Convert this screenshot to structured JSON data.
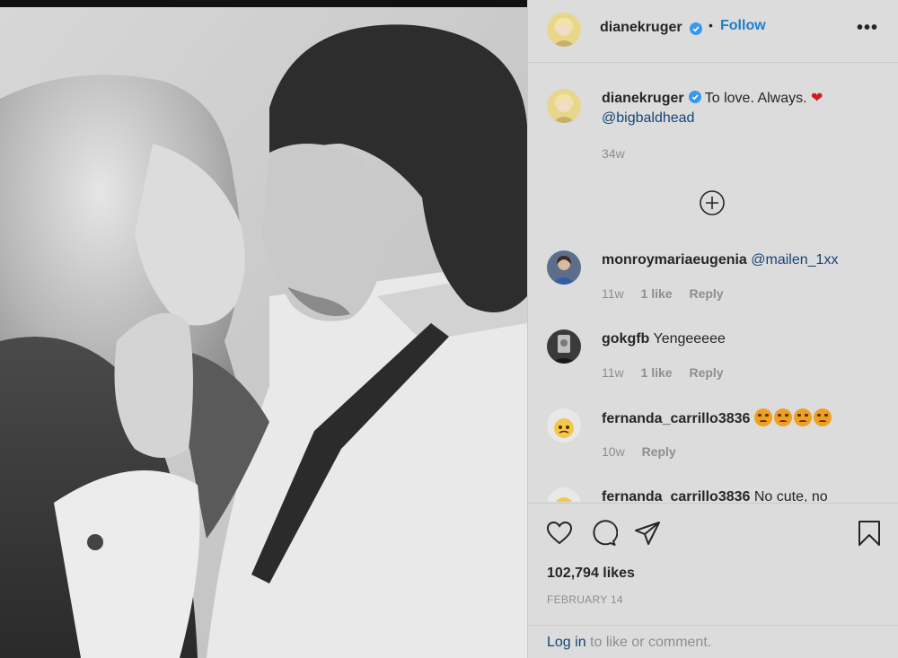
{
  "header": {
    "username": "dianekruger",
    "dot": "•",
    "follow_label": "Follow",
    "more_label": "•••"
  },
  "caption": {
    "username": "dianekruger",
    "text": "To love. Always.",
    "heart": "❤",
    "mention": "@bigbaldhead",
    "time": "34w"
  },
  "comments": [
    {
      "username": "monroymariaeugenia",
      "text": "",
      "mention": "@mailen_1xx",
      "time": "11w",
      "likes": "1 like",
      "reply": "Reply"
    },
    {
      "username": "gokgfb",
      "text": "Yengeeeee",
      "mention": "",
      "time": "11w",
      "likes": "1 like",
      "reply": "Reply"
    },
    {
      "username": "fernanda_carrillo3836",
      "text": "",
      "mention": "",
      "time": "10w",
      "likes": "",
      "reply": "Reply"
    },
    {
      "username": "fernanda_carrillo3836",
      "text": "No cute, no",
      "mention": "",
      "time": "",
      "likes": "",
      "reply": ""
    }
  ],
  "actions": {
    "likes": "102,794 likes",
    "date": "FEBRUARY 14"
  },
  "login": {
    "link": "Log in",
    "rest": "to like or comment."
  },
  "colors": {
    "accent": "#1c80c8",
    "verified": "#3897f0",
    "mention": "#14437a",
    "muted": "#8e8e8e"
  },
  "icons": [
    "verified-badge-icon",
    "add-circle-icon",
    "heart-icon",
    "comment-icon",
    "share-icon",
    "bookmark-icon",
    "more-icon"
  ]
}
